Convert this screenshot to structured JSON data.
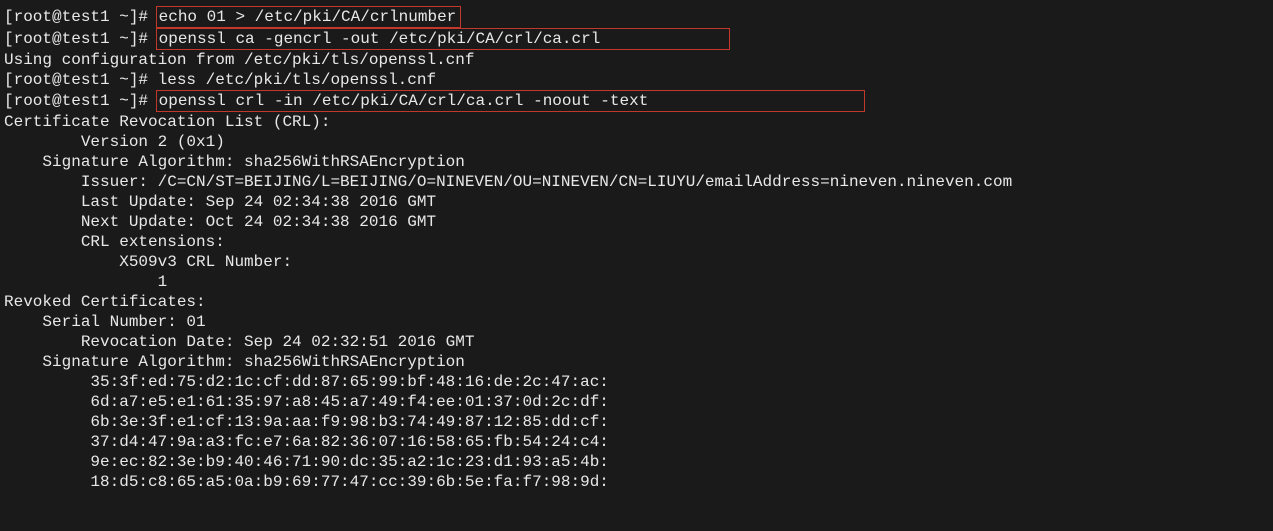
{
  "lines": [
    {
      "prompt": "[root@test1 ~]# ",
      "cmd": "echo 01 > /etc/pki/CA/crlnumber",
      "boxed": true
    },
    {
      "prompt": "[root@test1 ~]# ",
      "cmd": "openssl ca -gencrl -out /etc/pki/CA/crl/ca.crl",
      "boxed": true,
      "boxpad": "             "
    },
    {
      "text": "Using configuration from /etc/pki/tls/openssl.cnf"
    },
    {
      "prompt": "[root@test1 ~]# ",
      "cmd": "less /etc/pki/tls/openssl.cnf"
    },
    {
      "prompt": "[root@test1 ~]# ",
      "cmd": "openssl crl -in /etc/pki/CA/crl/ca.crl -noout -text",
      "boxed": true,
      "boxpad": "                      "
    },
    {
      "text": "Certificate Revocation List (CRL):"
    },
    {
      "text": "        Version 2 (0x1)"
    },
    {
      "text": "    Signature Algorithm: sha256WithRSAEncryption"
    },
    {
      "text": "        Issuer: /C=CN/ST=BEIJING/L=BEIJING/O=NINEVEN/OU=NINEVEN/CN=LIUYU/emailAddress=nineven.nineven.com"
    },
    {
      "text": "        Last Update: Sep 24 02:34:38 2016 GMT"
    },
    {
      "text": "        Next Update: Oct 24 02:34:38 2016 GMT"
    },
    {
      "text": "        CRL extensions:"
    },
    {
      "text": "            X509v3 CRL Number: "
    },
    {
      "text": "                1"
    },
    {
      "text": "Revoked Certificates:"
    },
    {
      "text": "    Serial Number: 01"
    },
    {
      "text": "        Revocation Date: Sep 24 02:32:51 2016 GMT"
    },
    {
      "text": "    Signature Algorithm: sha256WithRSAEncryption"
    },
    {
      "text": "         35:3f:ed:75:d2:1c:cf:dd:87:65:99:bf:48:16:de:2c:47:ac:"
    },
    {
      "text": "         6d:a7:e5:e1:61:35:97:a8:45:a7:49:f4:ee:01:37:0d:2c:df:"
    },
    {
      "text": "         6b:3e:3f:e1:cf:13:9a:aa:f9:98:b3:74:49:87:12:85:dd:cf:"
    },
    {
      "text": "         37:d4:47:9a:a3:fc:e7:6a:82:36:07:16:58:65:fb:54:24:c4:"
    },
    {
      "text": "         9e:ec:82:3e:b9:40:46:71:90:dc:35:a2:1c:23:d1:93:a5:4b:"
    },
    {
      "text": "         18:d5:c8:65:a5:0a:b9:69:77:47:cc:39:6b:5e:fa:f7:98:9d:"
    }
  ]
}
